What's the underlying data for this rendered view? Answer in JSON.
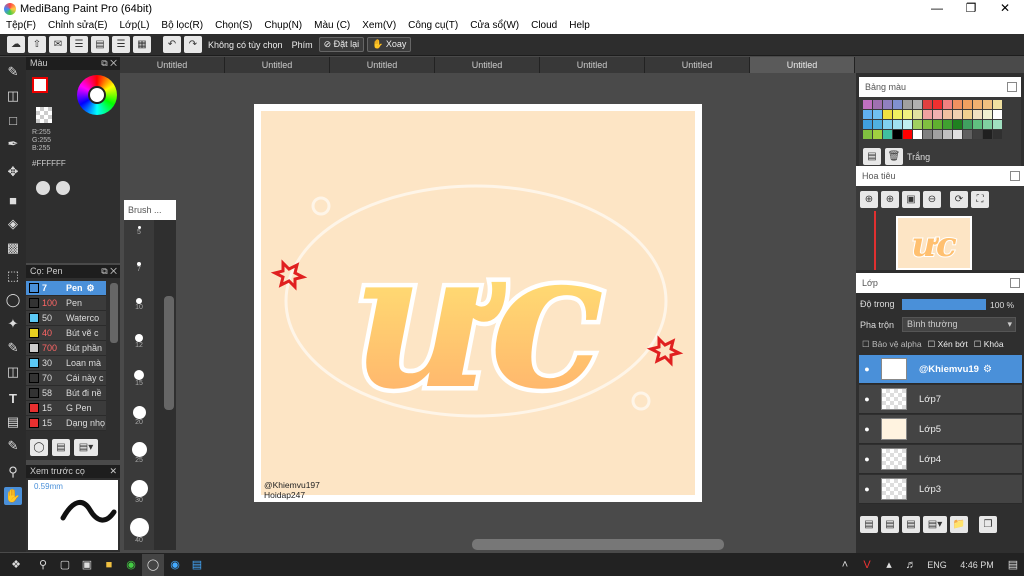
{
  "window": {
    "title": "MediBang Paint Pro (64bit)"
  },
  "menu": [
    "Tệp(F)",
    "Chỉnh sửa(E)",
    "Lớp(L)",
    "Bộ lọc(R)",
    "Chọn(S)",
    "Chụp(N)",
    "Màu (C)",
    "Xem(V)",
    "Công cụ(T)",
    "Cửa sổ(W)",
    "Cloud",
    "Help"
  ],
  "toolbar": {
    "option_label": "Không có tùy chọn",
    "key_label": "Phím",
    "reset_label": "Đặt lại",
    "rotate_label": "Xoay"
  },
  "tabs": [
    "Untitled",
    "Untitled",
    "Untitled",
    "Untitled",
    "Untitled",
    "Untitled",
    "Untitled"
  ],
  "color_panel": {
    "title": "Màu",
    "r": "R:255",
    "g": "G:255",
    "b": "B:255",
    "hex": "#FFFFFF"
  },
  "brush_panel": {
    "title": "Cọ: Pen",
    "brushes": [
      {
        "size": "7",
        "name": "Pen",
        "color": "#4a90d9"
      },
      {
        "size": "100",
        "name": "Pen",
        "color": "#333333"
      },
      {
        "size": "50",
        "name": "Waterco",
        "color": "#5bc8f5"
      },
      {
        "size": "40",
        "name": "Bút vẽ c",
        "color": "#e8d020"
      },
      {
        "size": "700",
        "name": "Bút phần",
        "color": "#cccccc"
      },
      {
        "size": "30",
        "name": "Loan mà",
        "color": "#5bc8f5"
      },
      {
        "size": "70",
        "name": "Cái này c",
        "color": "#333333"
      },
      {
        "size": "58",
        "name": "Bút đi nề",
        "color": "#333333"
      },
      {
        "size": "15",
        "name": "G Pen",
        "color": "#e83030"
      },
      {
        "size": "15",
        "name": "Dạng nhọ",
        "color": "#e83030"
      }
    ]
  },
  "preview_panel": {
    "title": "Xem trước cọ",
    "size_label": "0.59mm"
  },
  "brush_size_panel": {
    "title": "Brush ...",
    "sizes": [
      "5",
      "7",
      "10",
      "12",
      "15",
      "20",
      "25",
      "30",
      "40"
    ]
  },
  "canvas": {
    "watermark_line1": "@Khiemvu197",
    "watermark_line2": "Hoidap247",
    "art_text": "ưc"
  },
  "palette_panel": {
    "title": "Bảng màu",
    "selected_label": "Trắng",
    "colors": [
      "#c070c0",
      "#a070b0",
      "#9080c0",
      "#8090d0",
      "#a0a0a0",
      "#b0b0b0",
      "#e04040",
      "#f03030",
      "#f08080",
      "#f09060",
      "#f0a060",
      "#f0b070",
      "#f0c080",
      "#f0e0a0",
      "#60b0f0",
      "#70c0f0",
      "#f0e040",
      "#f0f060",
      "#f0f080",
      "#e0e0a0",
      "#f0a0a0",
      "#f0b0b0",
      "#f0c0a0",
      "#f0d0b0",
      "#f0d090",
      "#f0e0c0",
      "#f0f0d0",
      "#ffffff",
      "#40a0e0",
      "#50b0e0",
      "#80d0f0",
      "#a0e0f0",
      "#c0f0f0",
      "#a0d060",
      "#80c040",
      "#60b030",
      "#40a030",
      "#208020",
      "#40a060",
      "#60c080",
      "#80d0a0",
      "#a0e0c0",
      "#80c040",
      "#a0d040",
      "#40c0a0",
      "#000000",
      "#ff0000",
      "#ffffff",
      "#808080",
      "#a0a0a0",
      "#c0c0c0",
      "#e0e0e0",
      "#606060",
      "#404040",
      "#202020",
      "#303030"
    ]
  },
  "navigator_panel": {
    "title": "Hoa tiêu"
  },
  "layer_panel": {
    "title": "Lớp",
    "opacity_label": "Độ trong",
    "opacity_value": "100 %",
    "opacity": 1.0,
    "blend_label": "Pha trộn",
    "blend_value": "Bình thường",
    "protect_alpha": "Bảo vệ alpha",
    "clipping": "Xén bớt",
    "lock": "Khóa",
    "layers": [
      "@Khiemvu19",
      "Lớp7",
      "Lớp5",
      "Lớp4",
      "Lớp3"
    ]
  },
  "taskbar": {
    "language": "ENG",
    "time": "4:46 PM"
  }
}
